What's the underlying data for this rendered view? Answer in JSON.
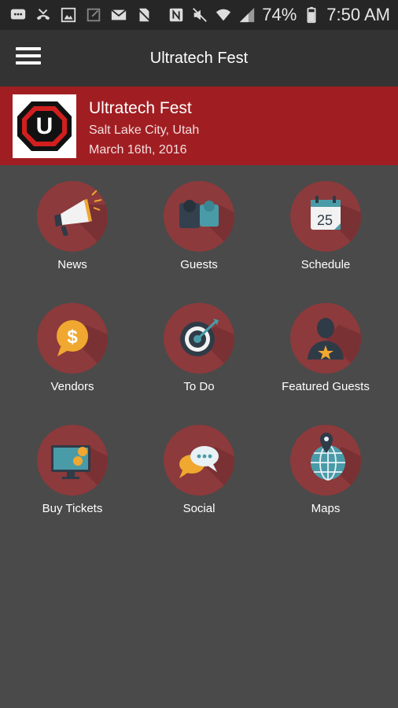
{
  "status_bar": {
    "battery": "74%",
    "time": "7:50 AM",
    "icons": [
      "message-icon",
      "missed-call-icon",
      "gallery-icon",
      "external-link-icon",
      "email-icon",
      "no-sim-icon",
      "nfc-icon",
      "mute-icon",
      "wifi-icon",
      "signal-icon",
      "battery-icon"
    ]
  },
  "app_bar": {
    "title": "Ultratech Fest",
    "menu_icon": "hamburger-menu-icon"
  },
  "event": {
    "name": "Ultratech Fest",
    "location": "Salt Lake City, Utah",
    "date": "March 16th, 2016",
    "logo_letter": "U"
  },
  "menu": [
    {
      "label": "News",
      "icon": "megaphone-icon"
    },
    {
      "label": "Guests",
      "icon": "people-icon"
    },
    {
      "label": "Schedule",
      "icon": "calendar-icon",
      "calendar_day": "25"
    },
    {
      "label": "Vendors",
      "icon": "dollar-coin-icon"
    },
    {
      "label": "To Do",
      "icon": "target-icon"
    },
    {
      "label": "Featured Guests",
      "icon": "featured-person-icon"
    },
    {
      "label": "Buy Tickets",
      "icon": "monitor-coins-icon"
    },
    {
      "label": "Social",
      "icon": "chat-bubbles-icon"
    },
    {
      "label": "Maps",
      "icon": "globe-pin-icon"
    }
  ],
  "colors": {
    "background": "#4a4a4a",
    "app_bar": "#333333",
    "status_bar": "#262626",
    "banner": "#a01e22",
    "icon_circle": "#8c3a3c"
  }
}
